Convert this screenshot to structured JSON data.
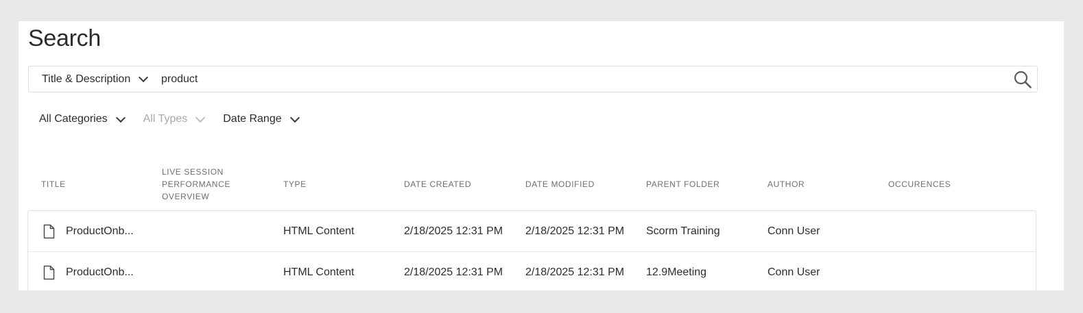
{
  "page": {
    "title": "Search"
  },
  "search": {
    "scope_label": "Title & Description",
    "query": "product"
  },
  "filters": {
    "categories": "All Categories",
    "types": "All Types",
    "date_range": "Date Range"
  },
  "table": {
    "headers": {
      "title": "TITLE",
      "live_session": "LIVE SESSION PERFORMANCE OVERVIEW",
      "type": "TYPE",
      "date_created": "DATE CREATED",
      "date_modified": "DATE MODIFIED",
      "parent_folder": "PARENT FOLDER",
      "author": "AUTHOR",
      "occurences": "OCCURENCES"
    },
    "rows": [
      {
        "title": "ProductOnb...",
        "type": "HTML Content",
        "date_created": "2/18/2025 12:31 PM",
        "date_modified": "2/18/2025 12:31 PM",
        "parent_folder": "Scorm Training",
        "author": "Conn User",
        "icon": "file-icon"
      },
      {
        "title": "ProductOnb...",
        "type": "HTML Content",
        "date_created": "2/18/2025 12:31 PM",
        "date_modified": "2/18/2025 12:31 PM",
        "parent_folder": "12.9Meeting",
        "author": "Conn User",
        "icon": "file-icon"
      }
    ]
  },
  "colors": {
    "page_bg": "#e9e9e9",
    "panel_bg": "#ffffff",
    "text": "#2c2c2c",
    "muted": "#6e6e6e",
    "disabled": "#a9a9a9"
  }
}
